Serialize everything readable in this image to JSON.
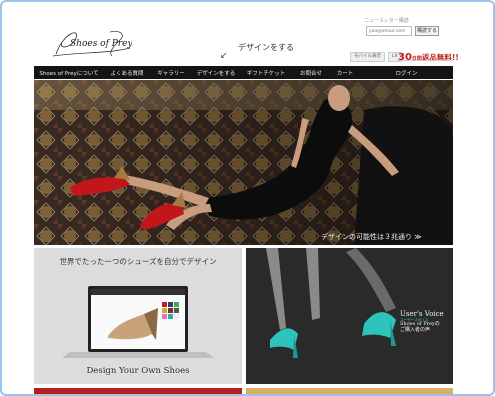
{
  "header": {
    "logo_text": "Shoes of Prey",
    "design_cta": "デザインをする",
    "newsletter": {
      "label": "ニュースレター購読",
      "placeholder": "you@email.com",
      "button": "購読する"
    },
    "utility": {
      "mobile_label": "モバイル表示",
      "lang_label": "LX"
    },
    "shipping": {
      "number": "30",
      "unit": "日間",
      "free": "返品無料!!"
    }
  },
  "nav": {
    "items": [
      "Shoes of Preyについて",
      "よくある質問",
      "ギャラリー",
      "デザインをする",
      "ギフトチケット",
      "お問合せ",
      "カート",
      "ログイン"
    ]
  },
  "hero": {
    "caption": "デザインの可能性は３兆通り ≫"
  },
  "panels": {
    "left_heading": "世界でたった一つのシューズを自分でデザイン",
    "left_label": "Design Your Own Shoes",
    "right_title": "User's Voice",
    "right_sub": "ユーザーズボイス",
    "right_line1": "Shoes of Preyの",
    "right_line2": "ご購入者の声"
  },
  "colors": {
    "nav_bg": "#141414",
    "accent_red": "#c0201d",
    "teal": "#34c6c0"
  }
}
